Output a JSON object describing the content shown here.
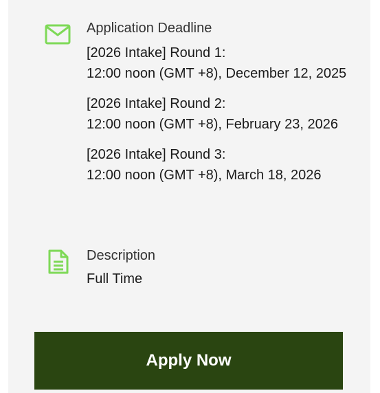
{
  "deadline": {
    "icon": "envelope-icon",
    "label": "Application Deadline",
    "rounds": [
      "[2026 Intake] Round 1:\n12:00 noon (GMT +8), December 12, 2025",
      "[2026 Intake] Round 2:\n12:00 noon (GMT +8), February 23, 2026",
      "[2026 Intake] Round 3:\n12:00 noon (GMT +8), March 18, 2026"
    ]
  },
  "description": {
    "icon": "document-icon",
    "label": "Description",
    "value": "Full Time"
  },
  "apply_button": {
    "label": "Apply Now"
  },
  "colors": {
    "accent_icon": "#7ed957",
    "button_bg": "#2a4511",
    "panel_bg": "#f4f4f4"
  }
}
